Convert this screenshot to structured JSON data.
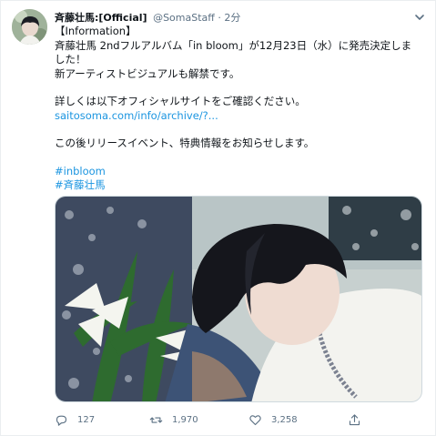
{
  "tweet": {
    "display_name": "斉藤壮馬:[Official]",
    "handle": "@SomaStaff",
    "separator": "·",
    "time": "2分",
    "lines": [
      "【Information】",
      "斉藤壮馬 2ndフルアルバム「in bloom」が12月23日（水）に発売決定しま",
      "した！",
      "新アーティストビジュアルも解禁です。"
    ],
    "lines2": [
      "詳しくは以下オフィシャルサイトをご確認ください。"
    ],
    "link": "saitosoma.com/info/archive/?...",
    "lines3": [
      "この後リリースイベント、特典情報をお知らせします。"
    ],
    "hashtags": [
      "#inbloom",
      "#斉藤壮馬"
    ]
  },
  "actions": {
    "reply_count": "127",
    "retweet_count": "1,970",
    "like_count": "3,258"
  },
  "icons": {
    "avatar": "avatar",
    "caret": "chevron-down-icon",
    "reply": "reply-icon",
    "retweet": "retweet-icon",
    "like": "heart-icon",
    "share": "share-icon"
  },
  "colors": {
    "link": "#1b95e0",
    "muted": "#5b7083",
    "text": "#0f1419"
  }
}
